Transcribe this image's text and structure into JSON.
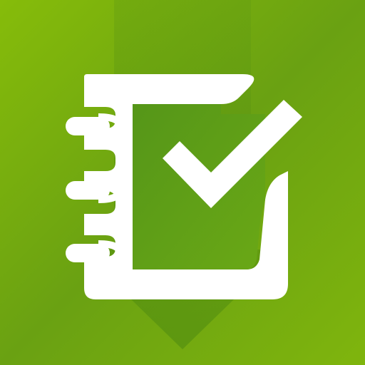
{
  "icon": {
    "name": "checklist-notebook-icon",
    "colors": {
      "background_light": "#8cc008",
      "background_dark": "#5e9512",
      "shadow_arrow": "#4d8a10",
      "page_fill": "#5d9e1a",
      "foreground": "#ffffff"
    }
  }
}
